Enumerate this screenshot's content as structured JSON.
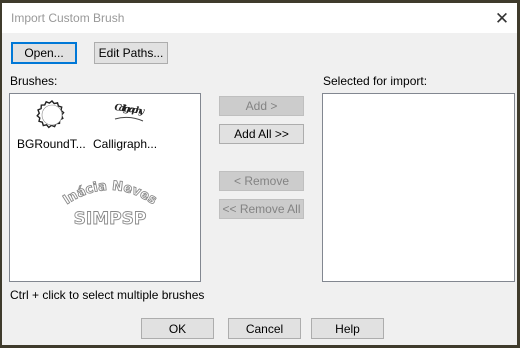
{
  "window": {
    "title": "Import Custom Brush",
    "close_symbol": "✕"
  },
  "toolbar": {
    "open_label": "Open...",
    "edit_paths_label": "Edit Paths..."
  },
  "brushes_panel": {
    "label": "Brushes:",
    "items": [
      {
        "name": "BGRoundT...",
        "icon": "round-brush-icon"
      },
      {
        "name": "Calligraph...",
        "icon": "calligraphy-brush-icon",
        "thumbnail_text": "Calligraphy"
      }
    ]
  },
  "watermark": {
    "line1": "Inácia Neves",
    "line2": "SIMPSP"
  },
  "actions": {
    "add_label": "Add >",
    "add_all_label": "Add All >>",
    "remove_label": "< Remove",
    "remove_all_label": "<< Remove All"
  },
  "selected_panel": {
    "label": "Selected for import:"
  },
  "hint": "Ctrl + click to select multiple brushes",
  "footer": {
    "ok_label": "OK",
    "cancel_label": "Cancel",
    "help_label": "Help"
  },
  "colors": {
    "accent": "#0078d7",
    "frame": "#3f3b2c",
    "dialog_bg": "#f0f0f0"
  }
}
